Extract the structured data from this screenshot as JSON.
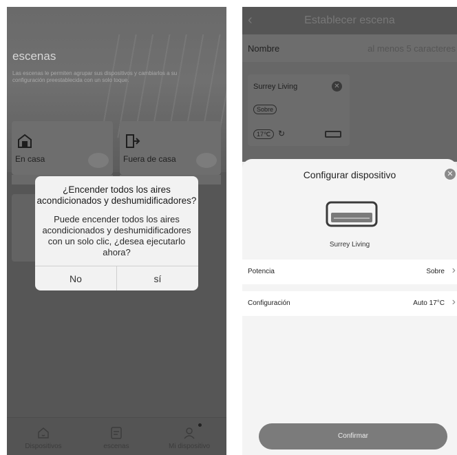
{
  "left": {
    "hero": {
      "title": "escenas",
      "description": "Las escenas le permiten agrupar sus dispositivos y cambiarlos a su configuración preestablecida con un solo toque."
    },
    "scenes": [
      {
        "label": "En casa",
        "icon": "home-icon"
      },
      {
        "label": "Fuera de casa",
        "icon": "door-exit-icon"
      }
    ],
    "dialog": {
      "title": "¿Encender todos los aires acondicionados y deshumidificadores?",
      "body": "Puede encender todos los aires acondicionados y deshumidificadores con un solo clic, ¿desea ejecutarlo ahora?",
      "no_label": "No",
      "yes_label": "sí"
    },
    "tabs": [
      {
        "label": "Dispositivos",
        "icon": "home-icon"
      },
      {
        "label": "escenas",
        "icon": "scene-list-icon"
      },
      {
        "label": "Mi dispositivo",
        "icon": "user-icon"
      }
    ]
  },
  "right": {
    "header": {
      "back_icon": "chevron-left-icon",
      "title": "Establecer escena"
    },
    "name_row": {
      "label": "Nombre",
      "placeholder": "al menos 5 caracteres"
    },
    "device_card": {
      "name": "Surrey Living",
      "power_pill": "Sobre",
      "temp_pill": "17℃",
      "remove_icon": "close-circle-icon"
    },
    "sheet": {
      "title": "Configurar dispositivo",
      "device_name": "Surrey Living",
      "rows": [
        {
          "label": "Potencia",
          "value": "Sobre"
        },
        {
          "label": "Configuración",
          "value": "Auto 17°C"
        }
      ],
      "confirm_label": "Confirmar"
    }
  },
  "colors": {
    "overlay": "#565656",
    "dialog_bg": "#f2f2f2",
    "sheet_bg": "#f4f4f4",
    "confirm_bg": "#7b7b7b"
  }
}
